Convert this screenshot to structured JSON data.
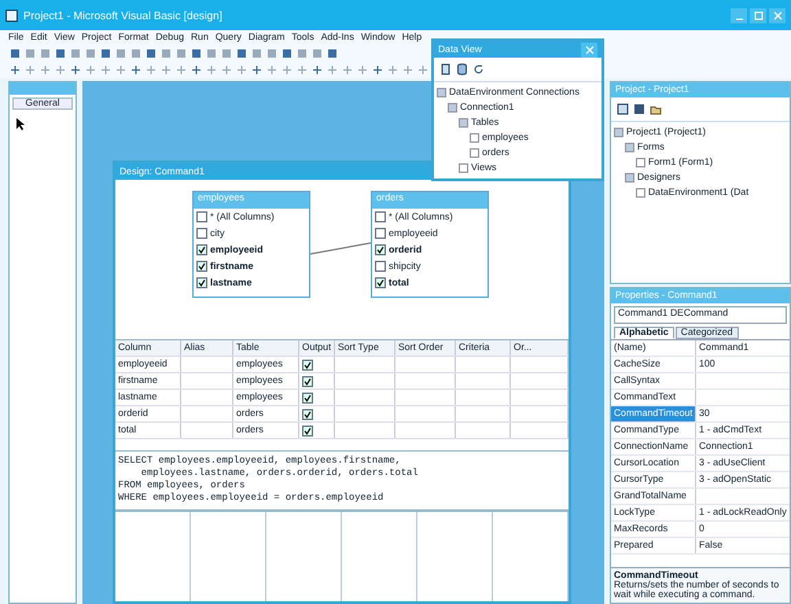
{
  "window": {
    "title": "Project1 - Microsoft Visual Basic [design]"
  },
  "menu": [
    "File",
    "Edit",
    "View",
    "Project",
    "Format",
    "Debug",
    "Run",
    "Query",
    "Diagram",
    "Tools",
    "Add-Ins",
    "Window",
    "Help"
  ],
  "toolbox": {
    "title": "General"
  },
  "data_view": {
    "title": "Data View",
    "tree": [
      {
        "label": "DataEnvironment Connections",
        "expanded": true,
        "children": [
          {
            "label": "Connection1",
            "expanded": true,
            "children": [
              {
                "label": "Tables",
                "expanded": true,
                "children": [
                  {
                    "label": "employees",
                    "expanded": false
                  },
                  {
                    "label": "orders",
                    "expanded": false
                  }
                ]
              },
              {
                "label": "Views",
                "expanded": false
              }
            ]
          }
        ]
      }
    ]
  },
  "designer": {
    "title": "Design: Command1",
    "tables": [
      {
        "name": "employees",
        "columns": [
          {
            "name": "* (All Columns)",
            "checked": false
          },
          {
            "name": "city",
            "checked": false
          },
          {
            "name": "employeeid",
            "checked": true
          },
          {
            "name": "firstname",
            "checked": true
          },
          {
            "name": "lastname",
            "checked": true
          }
        ]
      },
      {
        "name": "orders",
        "columns": [
          {
            "name": "* (All Columns)",
            "checked": false
          },
          {
            "name": "employeeid",
            "checked": false
          },
          {
            "name": "orderid",
            "checked": true
          },
          {
            "name": "shipcity",
            "checked": false
          },
          {
            "name": "total",
            "checked": true
          }
        ]
      }
    ],
    "grid": {
      "columns": [
        "Column",
        "Alias",
        "Table",
        "Output",
        "Sort Type",
        "Sort Order",
        "Criteria",
        "Or..."
      ],
      "rows": [
        {
          "column": "employeeid",
          "alias": "",
          "table": "employees",
          "output": true
        },
        {
          "column": "firstname",
          "alias": "",
          "table": "employees",
          "output": true
        },
        {
          "column": "lastname",
          "alias": "",
          "table": "employees",
          "output": true
        },
        {
          "column": "orderid",
          "alias": "",
          "table": "orders",
          "output": true
        },
        {
          "column": "total",
          "alias": "",
          "table": "orders",
          "output": true
        }
      ]
    },
    "sql": [
      "SELECT employees.employeeid, employees.firstname,",
      "    employees.lastname, orders.orderid, orders.total",
      "FROM employees, orders",
      "WHERE employees.employeeid = orders.employeeid"
    ]
  },
  "project": {
    "title": "Project - Project1",
    "tree": [
      {
        "label": "Project1 (Project1)",
        "expanded": true,
        "children": [
          {
            "label": "Forms",
            "expanded": true,
            "children": [
              {
                "label": "Form1 (Form1)",
                "expanded": false
              }
            ]
          },
          {
            "label": "Designers",
            "expanded": true,
            "children": [
              {
                "label": "DataEnvironment1 (Dat",
                "expanded": false
              }
            ]
          }
        ]
      }
    ]
  },
  "properties": {
    "title": "Properties - Command1",
    "object": "Command1 DECommand",
    "tabs": [
      {
        "label": "Alphabetic",
        "selected": true
      },
      {
        "label": "Categorized",
        "selected": false
      }
    ],
    "rows": [
      {
        "name": "(Name)",
        "value": "Command1",
        "selected": false
      },
      {
        "name": "CacheSize",
        "value": "100",
        "selected": false
      },
      {
        "name": "CallSyntax",
        "value": "",
        "selected": false
      },
      {
        "name": "CommandText",
        "value": "",
        "selected": false
      },
      {
        "name": "CommandTimeout",
        "value": "30",
        "selected": true
      },
      {
        "name": "CommandType",
        "value": "1 - adCmdText",
        "selected": false
      },
      {
        "name": "ConnectionName",
        "value": "Connection1",
        "selected": false
      },
      {
        "name": "CursorLocation",
        "value": "3 - adUseClient",
        "selected": false
      },
      {
        "name": "CursorType",
        "value": "3 - adOpenStatic",
        "selected": false
      },
      {
        "name": "GrandTotalName",
        "value": "",
        "selected": false
      },
      {
        "name": "LockType",
        "value": "1 - adLockReadOnly",
        "selected": false
      },
      {
        "name": "MaxRecords",
        "value": "0",
        "selected": false
      },
      {
        "name": "Prepared",
        "value": "False",
        "selected": false
      }
    ],
    "description": {
      "title": "CommandTimeout",
      "text": "Returns/sets the number of seconds to wait while executing a command."
    }
  }
}
